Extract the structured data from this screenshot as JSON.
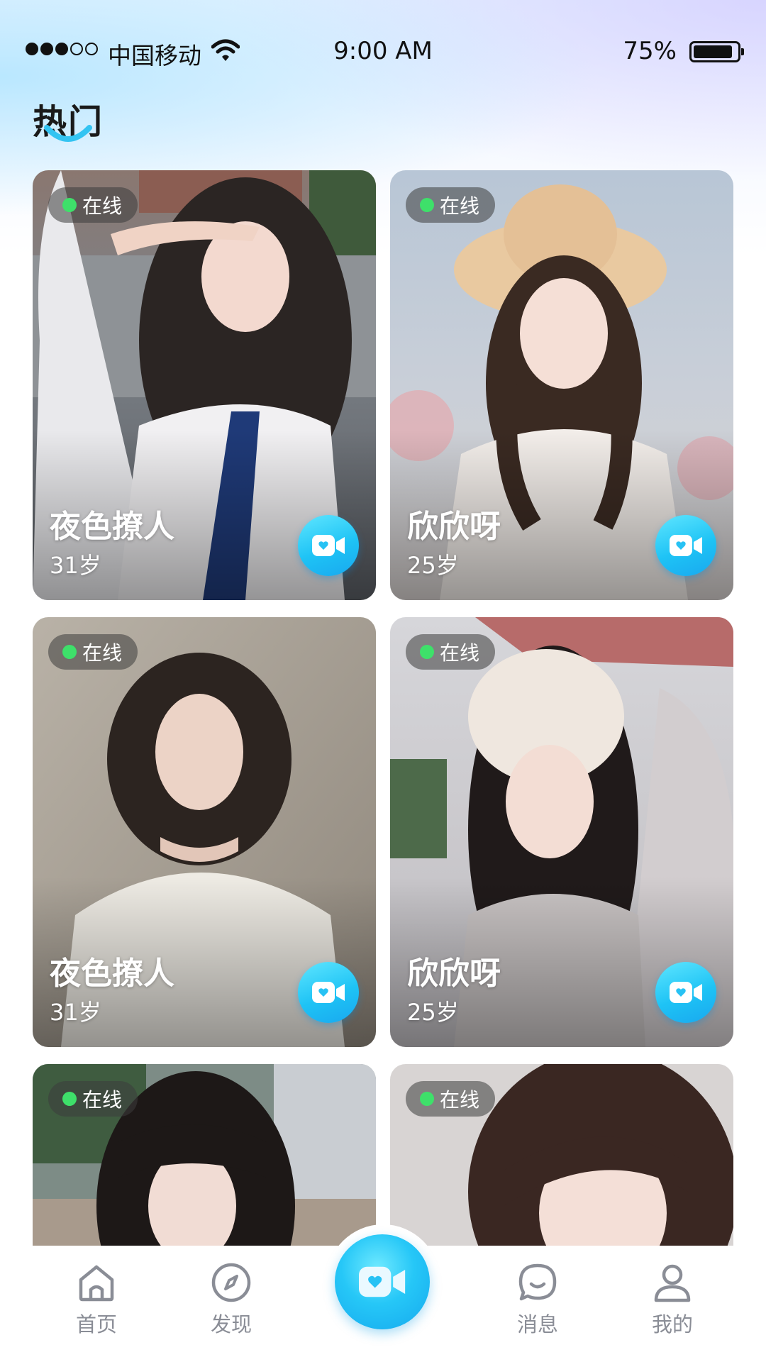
{
  "status_bar": {
    "signal_filled": 3,
    "signal_total": 5,
    "carrier": "中国移动",
    "time": "9:00 AM",
    "battery_percent": "75%",
    "battery_level": 0.9
  },
  "section": {
    "title": "热门"
  },
  "cards": [
    {
      "status": "在线",
      "name": "夜色撩人",
      "age": "31岁",
      "photo": "schoolgirl-street-photo"
    },
    {
      "status": "在线",
      "name": "欣欣呀",
      "age": "25岁",
      "photo": "straw-hat-girl-photo"
    },
    {
      "status": "在线",
      "name": "夜色撩人",
      "age": "31岁",
      "photo": "short-hair-sweater-photo"
    },
    {
      "status": "在线",
      "name": "欣欣呀",
      "age": "25岁",
      "photo": "knit-beanie-girl-photo"
    },
    {
      "status": "在线",
      "name": "",
      "age": "",
      "photo": "city-bangs-girl-photo"
    },
    {
      "status": "在线",
      "name": "",
      "age": "",
      "photo": "long-hair-girl-photo"
    }
  ],
  "tabbar": {
    "items": [
      {
        "label": "首页",
        "icon": "home-icon"
      },
      {
        "label": "发现",
        "icon": "compass-icon"
      },
      {
        "label": "",
        "icon": "video-call-icon"
      },
      {
        "label": "消息",
        "icon": "chat-bubble-icon"
      },
      {
        "label": "我的",
        "icon": "user-icon"
      }
    ]
  },
  "colors": {
    "accent": "#1ec3f5",
    "online": "#3ee06a",
    "tab_label": "#8a8d96"
  }
}
